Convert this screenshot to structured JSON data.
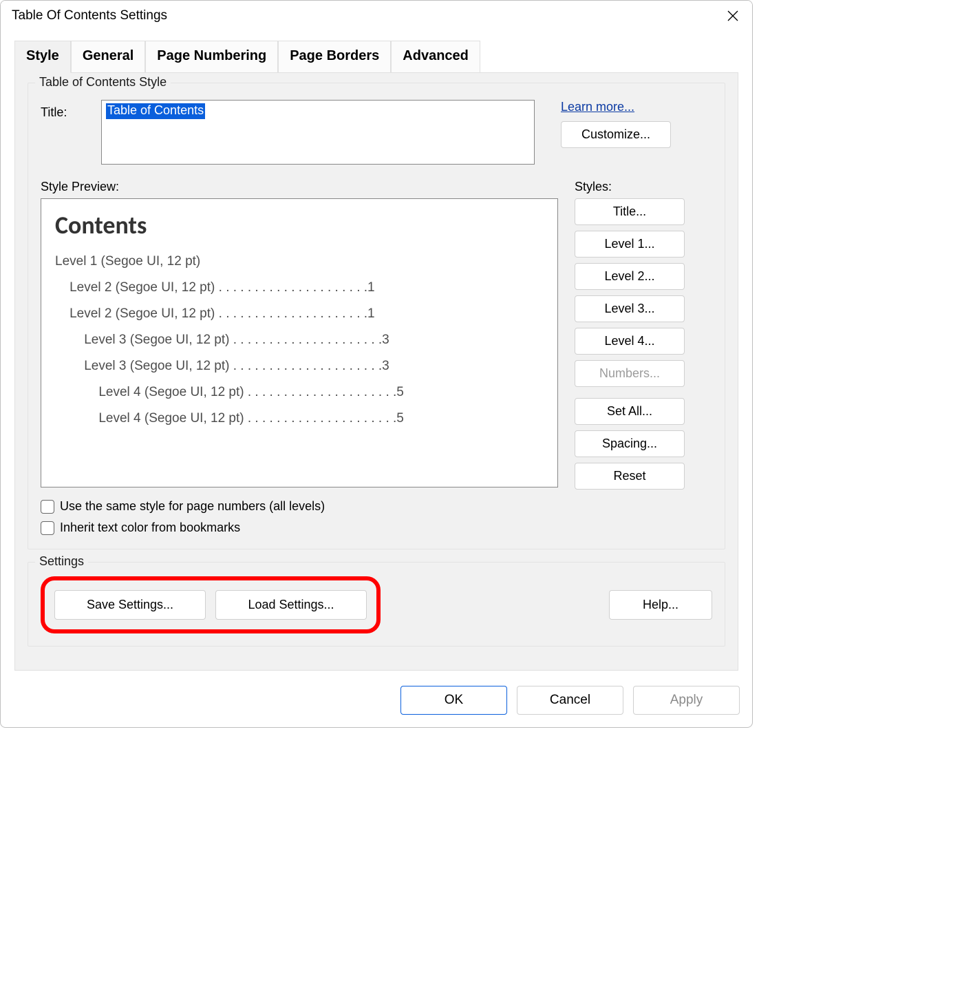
{
  "dialog": {
    "title": "Table Of Contents Settings"
  },
  "tabs": {
    "style": "Style",
    "general": "General",
    "page_numbering": "Page Numbering",
    "page_borders": "Page Borders",
    "advanced": "Advanced"
  },
  "style_group": {
    "legend": "Table of Contents Style",
    "title_label": "Title:",
    "title_value": "Table of Contents",
    "learn_more": "Learn more...",
    "customize": "Customize..."
  },
  "preview": {
    "label": "Style Preview:",
    "heading": "Contents",
    "lines": [
      "Level 1 (Segoe UI, 12 pt)",
      "    Level 2 (Segoe UI, 12 pt) . . . . . . . . . . . . . . . . . . . . .1",
      "    Level 2 (Segoe UI, 12 pt) . . . . . . . . . . . . . . . . . . . . .1",
      "        Level 3 (Segoe UI, 12 pt) . . . . . . . . . . . . . . . . . . . . .3",
      "        Level 3 (Segoe UI, 12 pt) . . . . . . . . . . . . . . . . . . . . .3",
      "            Level 4 (Segoe UI, 12 pt) . . . . . . . . . . . . . . . . . . . . .5",
      "            Level 4 (Segoe UI, 12 pt) . . . . . . . . . . . . . . . . . . . . .5"
    ]
  },
  "styles": {
    "label": "Styles:",
    "title_btn": "Title...",
    "level1": "Level 1...",
    "level2": "Level 2...",
    "level3": "Level 3...",
    "level4": "Level 4...",
    "numbers": "Numbers...",
    "set_all": "Set All...",
    "spacing": "Spacing...",
    "reset": "Reset"
  },
  "options": {
    "same_page_numbers": "Use the same style for page numbers (all levels)",
    "inherit_color": "Inherit text color from bookmarks"
  },
  "settings": {
    "legend": "Settings",
    "save": "Save Settings...",
    "load": "Load Settings...",
    "help": "Help..."
  },
  "footer": {
    "ok": "OK",
    "cancel": "Cancel",
    "apply": "Apply"
  }
}
